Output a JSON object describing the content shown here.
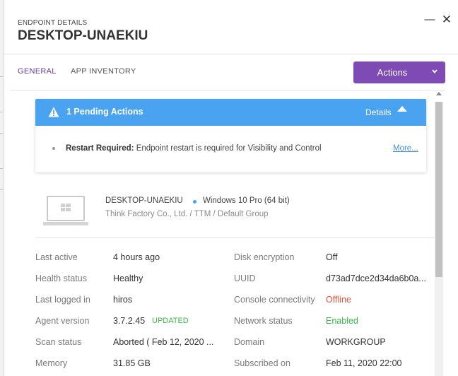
{
  "header": {
    "label": "ENDPOINT DETAILS",
    "title": "DESKTOP-UNAEKIU"
  },
  "tabs": [
    {
      "label": "GENERAL",
      "active": true
    },
    {
      "label": "APP INVENTORY",
      "active": false
    }
  ],
  "actions_button": {
    "label": "Actions"
  },
  "pending": {
    "title": "1 Pending Actions",
    "details_label": "Details",
    "item_bold": "Restart Required:",
    "item_text": " Endpoint restart is required for Visibility and Control",
    "more_label": "More..."
  },
  "device": {
    "name": "DESKTOP-UNAEKIU",
    "os": "Windows 10 Pro (64 bit)",
    "group": "Think Factory Co., Ltd. / TTM / Default Group"
  },
  "properties_left": [
    {
      "key": "Last active",
      "value": "4 hours ago"
    },
    {
      "key": "Health status",
      "value": "Healthy"
    },
    {
      "key": "Last logged in",
      "value": "hiros"
    },
    {
      "key": "Agent version",
      "value": "3.7.2.45",
      "badge": "UPDATED"
    },
    {
      "key": "Scan status",
      "value": "Aborted ( Feb 12, 2020 ..."
    },
    {
      "key": "Memory",
      "value": "31.85 GB"
    }
  ],
  "properties_right": [
    {
      "key": "Disk encryption",
      "value": "Off"
    },
    {
      "key": "UUID",
      "value": "d73ad7dce2d34da6b0a..."
    },
    {
      "key": "Console connectivity",
      "value": "Offline"
    },
    {
      "key": "Network status",
      "value": "Enabled"
    },
    {
      "key": "Domain",
      "value": "WORKGROUP"
    },
    {
      "key": "Subscribed on",
      "value": "Feb 11, 2020 22:00"
    }
  ],
  "colors": {
    "accent": "#7e4bb5",
    "banner": "#4aa3f0",
    "offline": "#e0513d",
    "enabled": "#3ab54a"
  }
}
